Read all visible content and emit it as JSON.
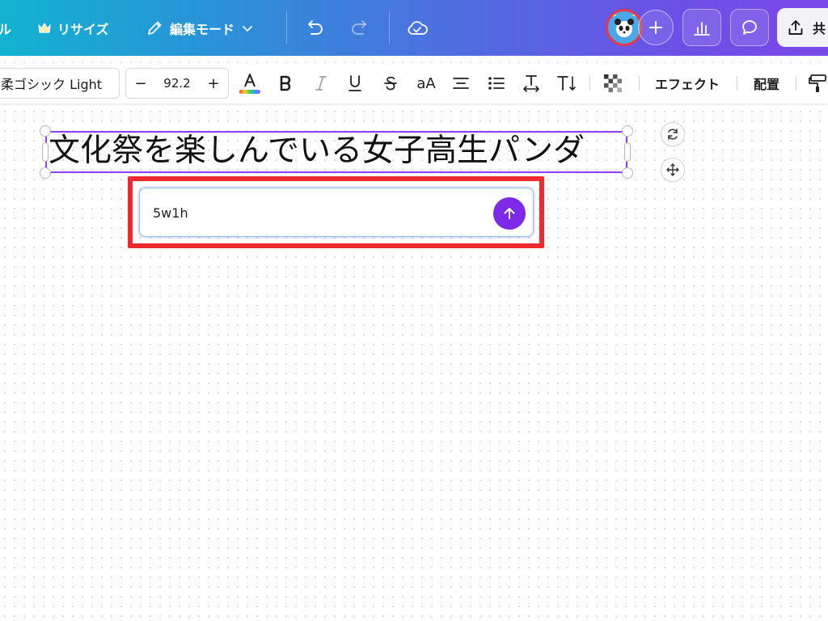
{
  "header": {
    "cut_label": "ル",
    "resize_label": "リサイズ",
    "edit_mode_label": "編集モード",
    "share_label": "共"
  },
  "toolbar": {
    "font_name": "柔ゴシック Light",
    "font_size": "92.2",
    "decrease": "−",
    "increase": "+",
    "case_label": "aA",
    "effects_label": "エフェクト",
    "arrange_label": "配置"
  },
  "canvas": {
    "headline": "文化祭を楽しんでいる女子高生パンダ"
  },
  "prompt": {
    "value": "5w1h"
  },
  "colors": {
    "accent": "#8b3dff",
    "submit": "#7d2ae8",
    "highlight": "#ee2a2f"
  }
}
